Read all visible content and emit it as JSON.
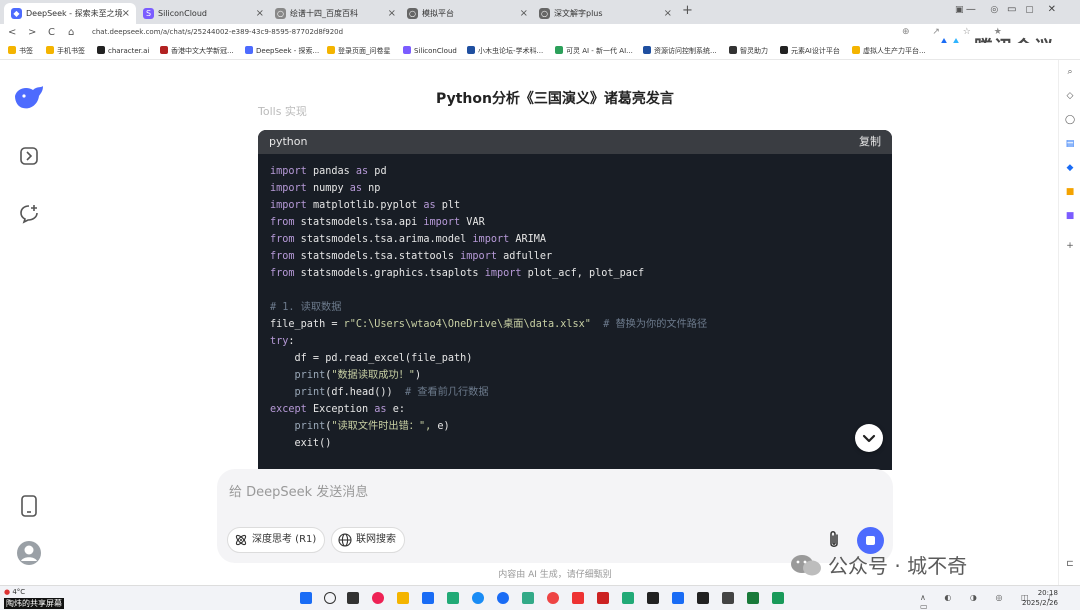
{
  "browser": {
    "tabs": [
      {
        "label": "DeepSeek - 探索未至之境",
        "color": "#4d6bfe"
      },
      {
        "label": "SiliconCloud",
        "color": "#7b5cff"
      },
      {
        "label": "绘谱十四_百度百科",
        "color": "#888888"
      },
      {
        "label": "模拟平台",
        "color": "#666666"
      },
      {
        "label": "深文解字plus",
        "color": "#666666"
      }
    ],
    "url": "chat.deepseek.com/a/chat/s/25244002-e389-43c9-8595-87702d8f920d",
    "bookmarks": [
      {
        "label": "书签",
        "color": "#f4b400"
      },
      {
        "label": "手机书签",
        "color": "#f4b400"
      },
      {
        "label": "character.ai",
        "color": "#222222"
      },
      {
        "label": "香港中文大学新冠...",
        "color": "#b22222"
      },
      {
        "label": "DeepSeek - 探索...",
        "color": "#4d6bfe"
      },
      {
        "label": "登录页面_问卷星",
        "color": "#f4b400"
      },
      {
        "label": "SiliconCloud",
        "color": "#7b5cff"
      },
      {
        "label": "小木虫论坛-学术科...",
        "color": "#1f4fa0"
      },
      {
        "label": "可灵 AI - 新一代 AI...",
        "color": "#2ca05a"
      },
      {
        "label": "资源访问控制系统...",
        "color": "#1f4fa0"
      },
      {
        "label": "智灵助力",
        "color": "#333333"
      },
      {
        "label": "元素AI设计平台",
        "color": "#222222"
      },
      {
        "label": "虚拟人生产力平台...",
        "color": "#f4b400"
      }
    ]
  },
  "watermark_top": "腾讯会议",
  "chat": {
    "title": "Python分析《三国演义》诸葛亮发言",
    "faded_text": "Tolls 实现",
    "code": {
      "lang": "python",
      "copy_label": "复制"
    },
    "composer": {
      "placeholder": "给 DeepSeek 发送消息",
      "deep_think": "深度思考 (R1)",
      "web_search": "联网搜索"
    },
    "disclaimer": "内容由 AI 生成，请仔细甄别"
  },
  "watermark_bottom": "公众号 · 城不奇",
  "taskbar": {
    "weather": "4°C",
    "share_label": "陶炜的共享屏幕",
    "time": "20:18",
    "date": "2025/2/26"
  }
}
